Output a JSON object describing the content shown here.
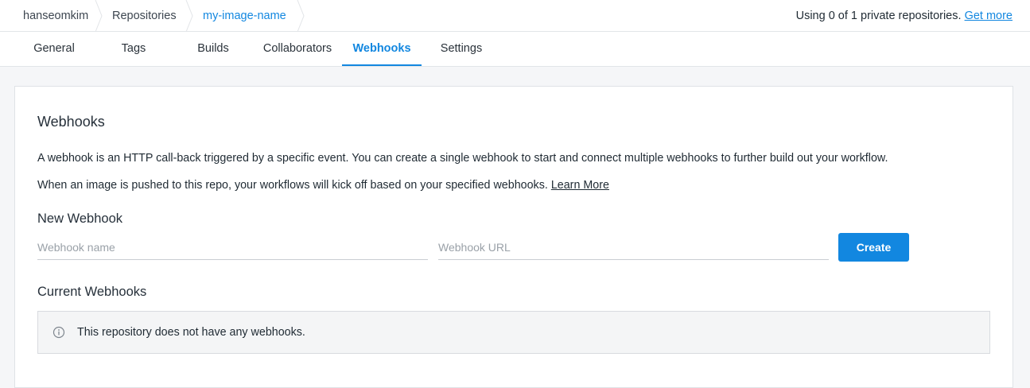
{
  "breadcrumb": {
    "items": [
      {
        "label": "hanseomkim"
      },
      {
        "label": "Repositories"
      },
      {
        "label": "my-image-name"
      }
    ]
  },
  "usage": {
    "text": "Using 0 of 1 private repositories.",
    "link": "Get more"
  },
  "tabs": [
    {
      "label": "General"
    },
    {
      "label": "Tags"
    },
    {
      "label": "Builds"
    },
    {
      "label": "Collaborators"
    },
    {
      "label": "Webhooks",
      "active": true
    },
    {
      "label": "Settings"
    }
  ],
  "main": {
    "title": "Webhooks",
    "description": "A webhook is an HTTP call-back triggered by a specific event. You can create a single webhook to start and connect multiple webhooks to further build out your workflow.",
    "info_text": "When an image is pushed to this repo, your workflows will kick off based on your specified webhooks.",
    "learn_more": "Learn More",
    "new_webhook_heading": "New Webhook",
    "name_placeholder": "Webhook name",
    "name_value": "",
    "url_placeholder": "Webhook URL",
    "url_value": "",
    "create_label": "Create",
    "current_webhooks_heading": "Current Webhooks",
    "empty_notice": "This repository does not have any webhooks."
  },
  "colors": {
    "accent": "#1287e0",
    "background": "#f5f6f8",
    "notice_background": "#f4f5f6"
  },
  "icons": {
    "notice": "info-circle-icon",
    "breadcrumb_separator": "chevron-right-icon"
  }
}
